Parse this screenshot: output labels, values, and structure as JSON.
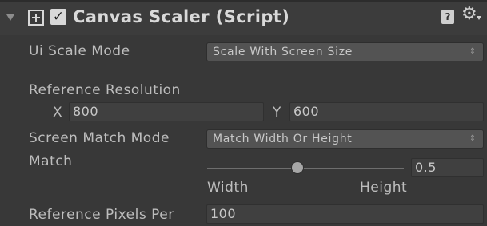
{
  "component": {
    "title": "Canvas Scaler (Script)",
    "enabled": true,
    "icon": "canvas-scaler-icon",
    "help_icon": "help-book-icon",
    "settings_icon": "gear-icon"
  },
  "ui_scale_mode": {
    "label": "Ui Scale Mode",
    "value": "Scale With Screen Size"
  },
  "reference_resolution": {
    "label": "Reference Resolution",
    "x_label": "X",
    "x_value": "800",
    "y_label": "Y",
    "y_value": "600"
  },
  "screen_match_mode": {
    "label": "Screen Match Mode",
    "value": "Match Width Or Height"
  },
  "match": {
    "label": "Match",
    "value": "0.5",
    "min_label": "Width",
    "max_label": "Height",
    "slider_fraction": 0.5
  },
  "reference_pixels_per_unit": {
    "label": "Reference Pixels Per",
    "value": "100"
  },
  "dropdown_arrow": "⇕"
}
